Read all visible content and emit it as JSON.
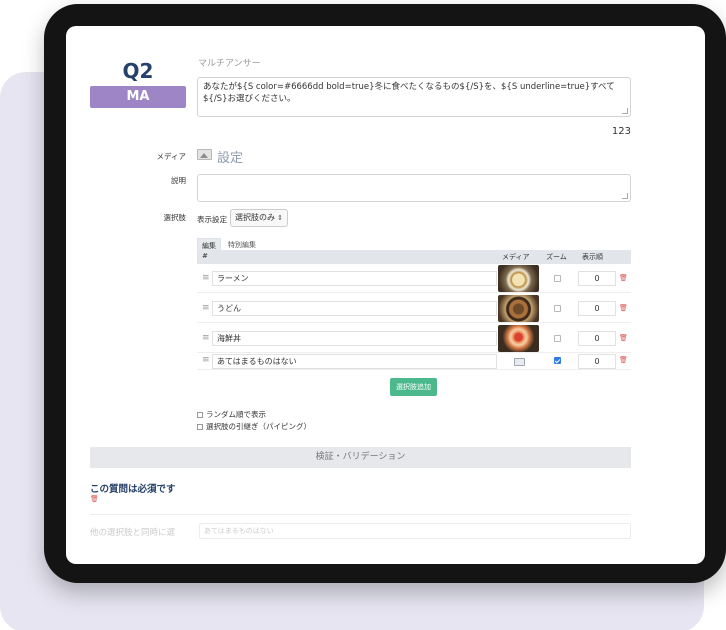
{
  "question": {
    "number": "Q2",
    "type_badge": "MA",
    "type_label": "マルチアンサー",
    "text": "あなたが${S color=#6666dd bold=true}冬に食べたくなるもの${/S}を、${S underline=true}すべて${/S}お選びください。",
    "char_count": "123"
  },
  "media": {
    "label": "メディア",
    "settings_label": "設定"
  },
  "description": {
    "label": "説明",
    "value": ""
  },
  "choices": {
    "label": "選択肢",
    "display_label": "表示設定",
    "display_value": "選択肢のみ",
    "tabs": [
      {
        "label": "編集",
        "active": true
      },
      {
        "label": "特別編集",
        "active": false
      }
    ],
    "columns": {
      "index": "#",
      "media": "メディア",
      "zoom": "ズーム",
      "order": "表示順"
    },
    "rows": [
      {
        "text": "ラーメン",
        "image": "ramen-photo",
        "zoom": false,
        "order": "0"
      },
      {
        "text": "うどん",
        "image": "udon-photo",
        "zoom": false,
        "order": "0"
      },
      {
        "text": "海鮮丼",
        "image": "kaisendon-photo",
        "zoom": false,
        "order": "0"
      },
      {
        "text": "あてはまるものはない",
        "image": "",
        "zoom": true,
        "order": "0"
      }
    ],
    "add_button": "選択肢追加",
    "options": [
      "ランダム順で表示",
      "選択肢の引継ぎ（パイピング）"
    ]
  },
  "validation": {
    "header": "検証・バリデーション",
    "required_title": "この質問は必須です",
    "faded_label": "他の選択肢と同時に選",
    "faded_value": "あてはまるものはない"
  },
  "colors": {
    "accent": "#27406b",
    "badge": "#9e86c6",
    "add_button": "#4bb98c",
    "danger": "#d9534f"
  }
}
